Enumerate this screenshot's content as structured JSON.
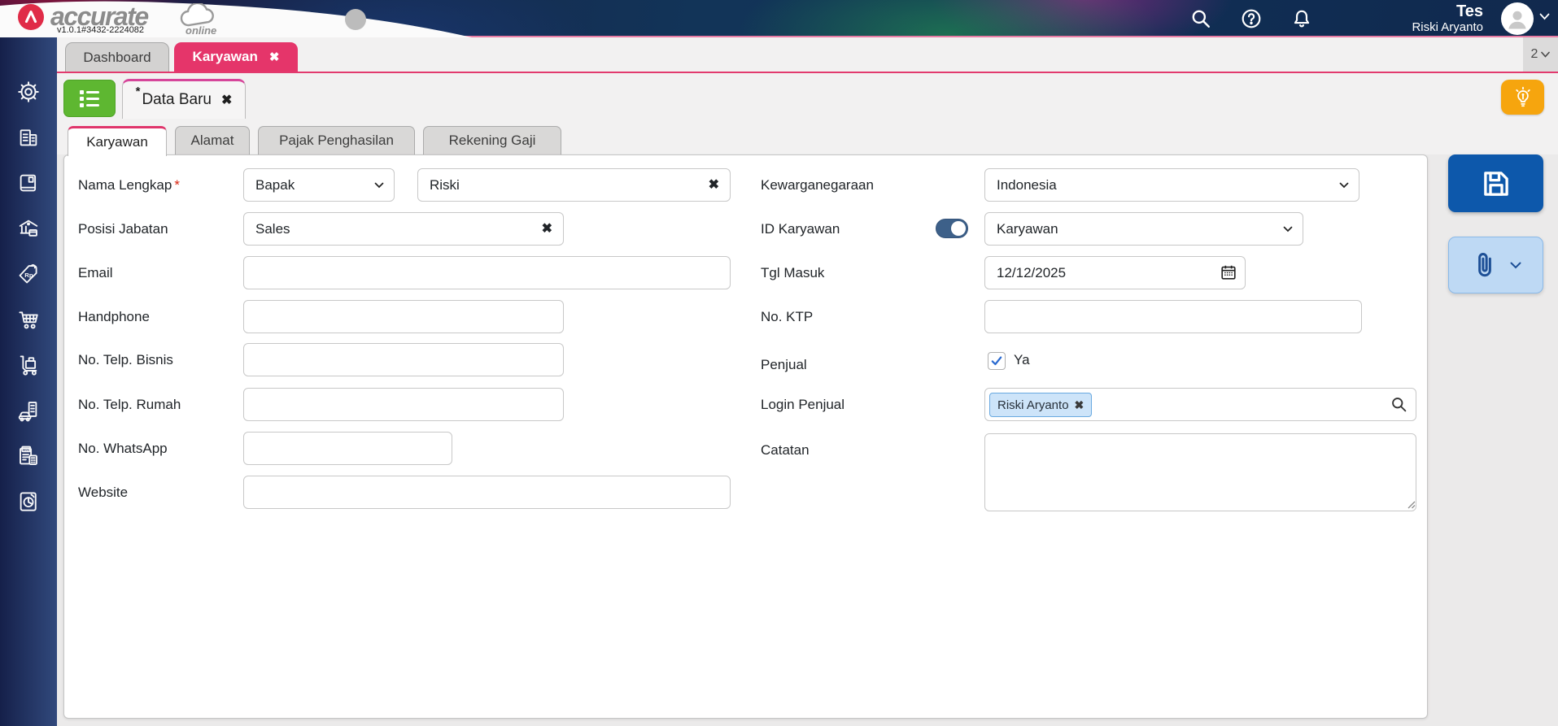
{
  "app": {
    "brand": "accurate",
    "brand_sub": "online",
    "version": "v1.0.1#3432-2224082"
  },
  "header": {
    "user_name": "Tes",
    "user_fullname": "Riski Aryanto"
  },
  "main_tabs": {
    "dashboard": "Dashboard",
    "karyawan": "Karyawan",
    "counter": "2"
  },
  "doc_tab": {
    "dirty": "*",
    "label": "Data Baru"
  },
  "form_tabs": {
    "karyawan": "Karyawan",
    "alamat": "Alamat",
    "pajak": "Pajak Penghasilan",
    "rekening": "Rekening Gaji"
  },
  "form": {
    "nama_lengkap": {
      "label": "Nama Lengkap",
      "required_mark": "*",
      "prefix_value": "Bapak",
      "value": "Riski"
    },
    "posisi_jabatan": {
      "label": "Posisi Jabatan",
      "value": "Sales"
    },
    "email": {
      "label": "Email",
      "value": ""
    },
    "handphone": {
      "label": "Handphone",
      "value": ""
    },
    "telp_bisnis": {
      "label": "No. Telp. Bisnis",
      "value": ""
    },
    "telp_rumah": {
      "label": "No. Telp. Rumah",
      "value": ""
    },
    "whatsapp": {
      "label": "No. WhatsApp",
      "value": ""
    },
    "website": {
      "label": "Website",
      "value": ""
    },
    "kewarganegaraan": {
      "label": "Kewarganegaraan",
      "value": "Indonesia"
    },
    "id_karyawan": {
      "label": "ID Karyawan",
      "value": "Karyawan"
    },
    "tgl_masuk": {
      "label": "Tgl Masuk",
      "value": "12/12/2025"
    },
    "no_ktp": {
      "label": "No. KTP",
      "value": ""
    },
    "penjual": {
      "label": "Penjual",
      "checkbox_label": "Ya"
    },
    "login_penjual": {
      "label": "Login Penjual",
      "chip": "Riski Aryanto"
    },
    "catatan": {
      "label": "Catatan",
      "value": ""
    }
  },
  "icons": {
    "close": "✖"
  },
  "colors": {
    "accent_pink": "#e5356a",
    "accent_magenta": "#d6459a",
    "green": "#5eb731",
    "yellow": "#f6a50e",
    "blue": "#0d58ab",
    "light_blue": "#bed9f4",
    "sidebar_navy": "#15204a"
  }
}
